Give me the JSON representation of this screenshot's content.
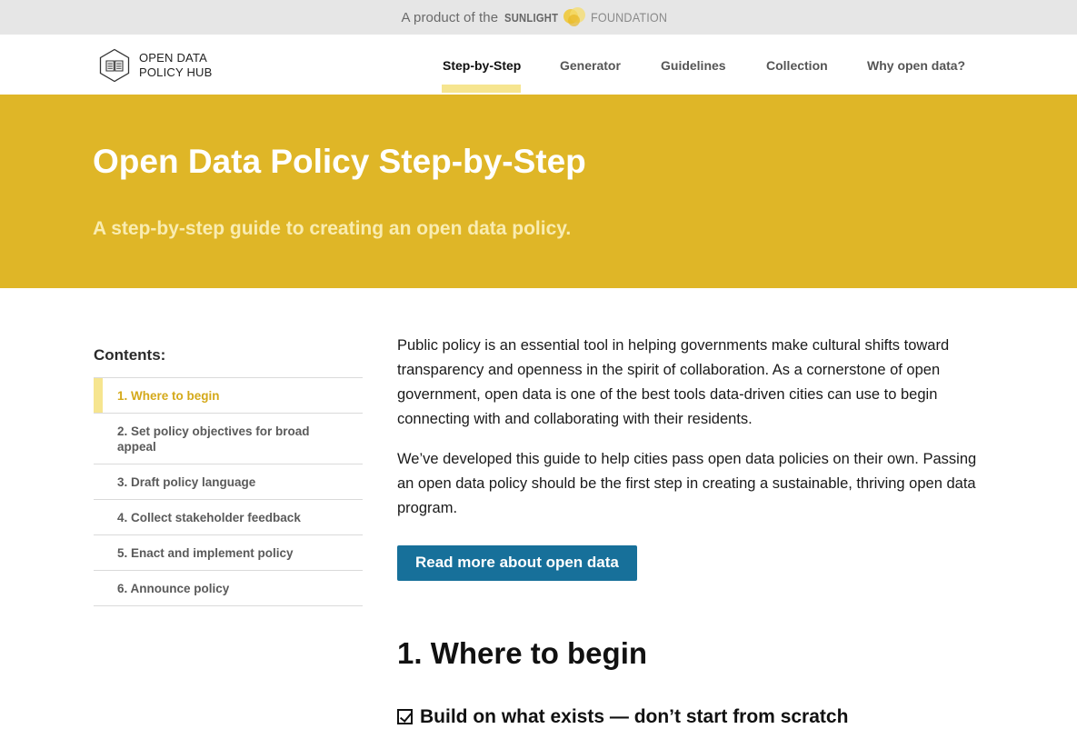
{
  "topbar": {
    "prefix": "A product of the",
    "brand_primary": "SUNLIGHT",
    "brand_secondary": "FOUNDATION"
  },
  "header": {
    "logo_line1": "OPEN DATA",
    "logo_line2": "POLICY HUB",
    "logo_icon": "open-book-hexagon-icon",
    "nav": [
      {
        "label": "Step-by-Step",
        "active": true
      },
      {
        "label": "Generator",
        "active": false
      },
      {
        "label": "Guidelines",
        "active": false
      },
      {
        "label": "Collection",
        "active": false
      },
      {
        "label": "Why open data?",
        "active": false
      }
    ]
  },
  "hero": {
    "title": "Open Data Policy Step-by-Step",
    "subtitle": "A step-by-step guide to creating an open data policy."
  },
  "sidebar": {
    "title": "Contents:",
    "items": [
      {
        "label": "1. Where to begin",
        "active": true
      },
      {
        "label": "2. Set policy objectives for broad appeal",
        "active": false
      },
      {
        "label": "3. Draft policy language",
        "active": false
      },
      {
        "label": "4. Collect stakeholder feedback",
        "active": false
      },
      {
        "label": "5. Enact and implement policy",
        "active": false
      },
      {
        "label": "6. Announce policy",
        "active": false
      }
    ]
  },
  "main": {
    "paragraph1": "Public policy is an essential tool in helping governments make cultural shifts toward transparency and openness in the spirit of collaboration. As a cornerstone of open government, open data is one of the best tools data-driven cities can use to begin connecting with and collaborating with their residents.",
    "paragraph2": "We’ve developed this guide to help cities pass open data policies on their own. Passing an open data policy should be the first step in creating a sustainable, thriving open data program.",
    "cta_label": "Read more about open data",
    "section_title": "1. Where to begin",
    "subsection_title": "Build on what exists — don’t start from scratch",
    "subsection_icon": "checkbox-checked-icon"
  },
  "colors": {
    "hero_bg": "#dfb627",
    "accent_light": "#f6e58f",
    "cta_bg": "#17709a",
    "topbar_bg": "#e6e6e6"
  }
}
